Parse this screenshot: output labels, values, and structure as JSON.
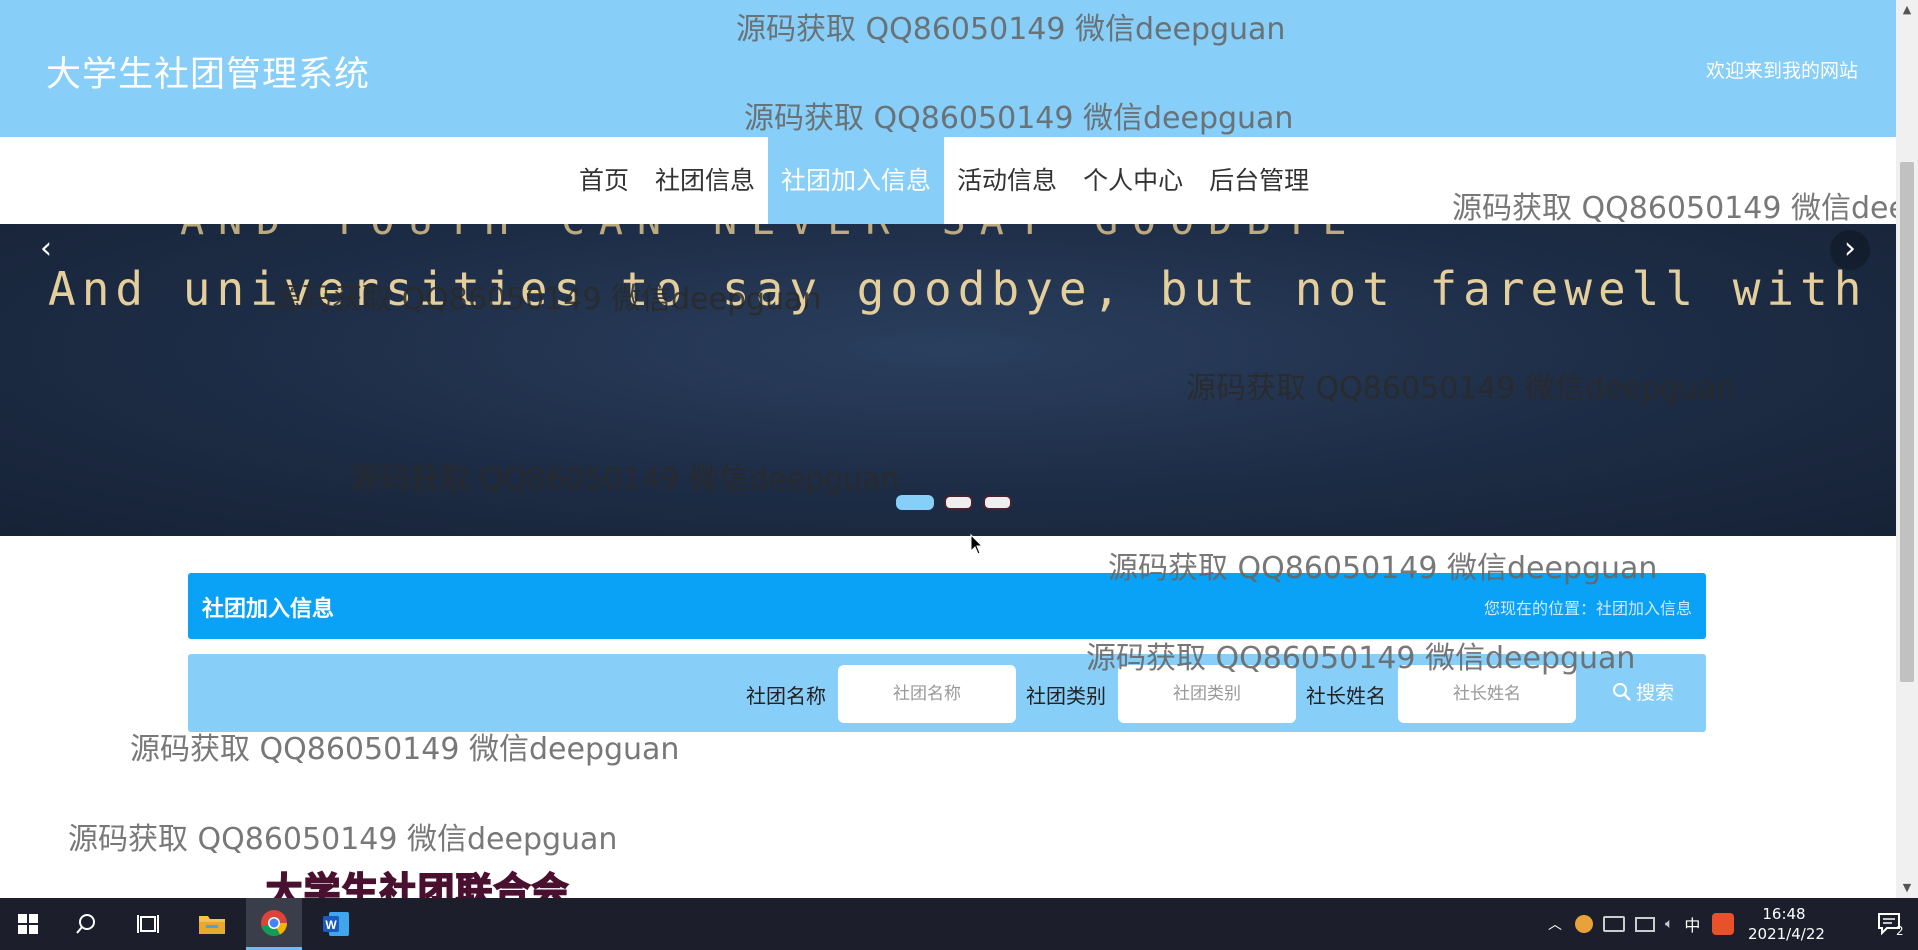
{
  "header": {
    "site_title": "大学生社团管理系统",
    "welcome_text": "欢迎来到我的网站"
  },
  "nav": {
    "items": [
      {
        "label": "首页"
      },
      {
        "label": "社团信息"
      },
      {
        "label": "社团加入信息",
        "active": true
      },
      {
        "label": "活动信息"
      },
      {
        "label": "个人中心"
      },
      {
        "label": "后台管理"
      }
    ]
  },
  "banner": {
    "top_text": "AND YOUTH CAN NEVER SAY GOODBYE",
    "text": "And universities to say goodbye, but not farewell with youth",
    "active_slide": 1,
    "slide_count": 3
  },
  "section": {
    "title": "社团加入信息",
    "breadcrumb": "您现在的位置：社团加入信息"
  },
  "search": {
    "fields": [
      {
        "label": "社团名称",
        "placeholder": "社团名称",
        "value": ""
      },
      {
        "label": "社团类别",
        "placeholder": "社团类别",
        "value": ""
      },
      {
        "label": "社长姓名",
        "placeholder": "社长姓名",
        "value": ""
      }
    ],
    "button_label": "搜索"
  },
  "logo_text": "大学生社团联合会",
  "watermark": "源码获取 QQ86050149 微信deepguan",
  "taskbar": {
    "time": "16:48",
    "date": "2021/4/22",
    "ime": "中",
    "notification_count": "2"
  },
  "colors": {
    "header_bg": "#87CEF8",
    "section_bar": "#0AA2F7",
    "taskbar_bg": "#1c1f2b"
  }
}
